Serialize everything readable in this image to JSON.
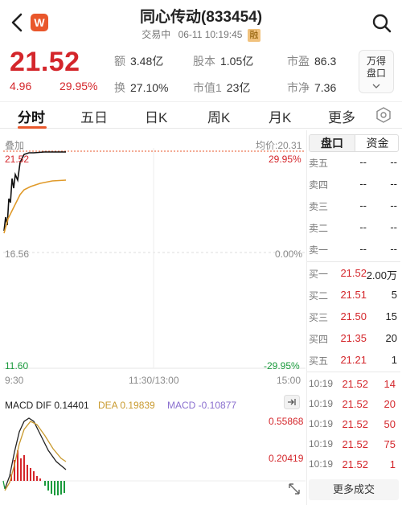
{
  "header": {
    "brand_badge": "W",
    "title": "同心传动(833454)",
    "status": "交易中",
    "datetime": "06-11 10:19:45",
    "tag": "融"
  },
  "quote": {
    "price": "21.52",
    "change": "4.96",
    "change_pct": "29.95%",
    "stats": [
      {
        "label": "额",
        "value": "3.48亿"
      },
      {
        "label": "股本",
        "value": "1.05亿"
      },
      {
        "label": "市盈",
        "value": "86.3"
      },
      {
        "label": "换",
        "value": "27.10%"
      },
      {
        "label": "市值1",
        "value": "23亿"
      },
      {
        "label": "市净",
        "value": "7.36"
      }
    ],
    "wande_label": "万得盘口"
  },
  "tabs": [
    "分时",
    "五日",
    "日K",
    "周K",
    "月K",
    "更多"
  ],
  "chart": {
    "overlay_label": "叠加",
    "avg_label": "均价:20.31",
    "price_high": "21.52",
    "price_mid": "16.56",
    "price_low": "11.60",
    "pct_high": "29.95%",
    "pct_mid": "0.00%",
    "pct_low": "-29.95%",
    "time_start": "9:30",
    "time_mid": "11:30/13:00",
    "time_end": "15:00"
  },
  "macd": {
    "dif": "MACD DIF 0.14401",
    "dea": "DEA 0.19839",
    "macd": "MACD -0.10877",
    "axis_high": "0.55868",
    "axis_low": "0.20419",
    "colors": {
      "dif": "#222222",
      "dea": "#c99a2e",
      "macd": "#8a6fcf"
    }
  },
  "panel": {
    "tab_active": "盘口",
    "tab_other": "资金",
    "asks": [
      {
        "name": "卖五",
        "price": "--",
        "vol": "--"
      },
      {
        "name": "卖四",
        "price": "--",
        "vol": "--"
      },
      {
        "name": "卖三",
        "price": "--",
        "vol": "--"
      },
      {
        "name": "卖二",
        "price": "--",
        "vol": "--"
      },
      {
        "name": "卖一",
        "price": "--",
        "vol": "--"
      }
    ],
    "bids": [
      {
        "name": "买一",
        "price": "21.52",
        "vol": "2.00万"
      },
      {
        "name": "买二",
        "price": "21.51",
        "vol": "5"
      },
      {
        "name": "买三",
        "price": "21.50",
        "vol": "15"
      },
      {
        "name": "买四",
        "price": "21.35",
        "vol": "20"
      },
      {
        "name": "买五",
        "price": "21.21",
        "vol": "1"
      }
    ],
    "trades": [
      {
        "time": "10:19",
        "price": "21.52",
        "vol": "14"
      },
      {
        "time": "10:19",
        "price": "21.52",
        "vol": "20"
      },
      {
        "time": "10:19",
        "price": "21.52",
        "vol": "50"
      },
      {
        "time": "10:19",
        "price": "21.52",
        "vol": "75"
      },
      {
        "time": "10:19",
        "price": "21.52",
        "vol": "1"
      }
    ],
    "more_trades": "更多成交"
  },
  "accent_color": "#d4262b",
  "icons": [
    "back-icon",
    "search-icon",
    "settings-icon",
    "expand-icon",
    "fullscreen-icon"
  ]
}
